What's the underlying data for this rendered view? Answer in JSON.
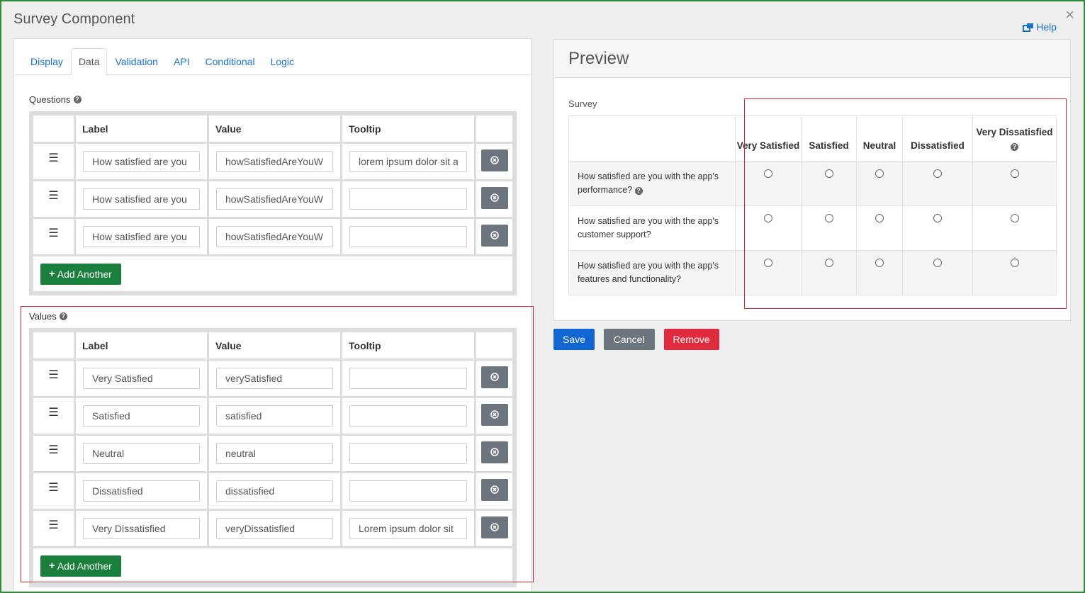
{
  "title": "Survey Component",
  "help_label": "Help",
  "tabs": [
    {
      "label": "Display"
    },
    {
      "label": "Data"
    },
    {
      "label": "Validation"
    },
    {
      "label": "API"
    },
    {
      "label": "Conditional"
    },
    {
      "label": "Logic"
    }
  ],
  "active_tab": "Data",
  "grid_headers": {
    "label": "Label",
    "value": "Value",
    "tooltip": "Tooltip"
  },
  "questions": {
    "heading": "Questions",
    "rows": [
      {
        "label": "How satisfied are you",
        "value": "howSatisfiedAreYouW",
        "tooltip": "lorem ipsum dolor sit a"
      },
      {
        "label": "How satisfied are you",
        "value": "howSatisfiedAreYouW",
        "tooltip": ""
      },
      {
        "label": "How satisfied are you",
        "value": "howSatisfiedAreYouW",
        "tooltip": ""
      }
    ],
    "add_label": "Add Another"
  },
  "values": {
    "heading": "Values",
    "rows": [
      {
        "label": "Very Satisfied",
        "value": "verySatisfied",
        "tooltip": ""
      },
      {
        "label": "Satisfied",
        "value": "satisfied",
        "tooltip": ""
      },
      {
        "label": "Neutral",
        "value": "neutral",
        "tooltip": ""
      },
      {
        "label": "Dissatisfied",
        "value": "dissatisfied",
        "tooltip": ""
      },
      {
        "label": "Very Dissatisfied",
        "value": "veryDissatisfied",
        "tooltip": "Lorem ipsum dolor sit"
      }
    ],
    "add_label": "Add Another"
  },
  "preview": {
    "heading": "Preview",
    "survey_label": "Survey",
    "columns": [
      "Very Satisfied",
      "Satisfied",
      "Neutral",
      "Dissatisfied",
      "Very Dissatisfied"
    ],
    "questions": [
      "How satisfied are you with the app's performance?",
      "How satisfied are you with the app's customer support?",
      "How satisfied are you with the app's features and functionality?"
    ]
  },
  "buttons": {
    "save": "Save",
    "cancel": "Cancel",
    "remove": "Remove"
  },
  "colors": {
    "frame_border": "#2e8b3a",
    "link": "#1a73c8",
    "add_button": "#1a7f3c",
    "remove_row_button": "#6c757d",
    "save": "#1266d4",
    "cancel": "#6c757d",
    "remove": "#e02a3e",
    "highlight_box": "#d62535"
  },
  "icons": {
    "close": "close-icon",
    "help": "external-link-icon",
    "drag": "drag-handle-icon",
    "remove_row": "remove-circle-icon",
    "question": "question-circle-icon",
    "add": "plus-icon"
  }
}
